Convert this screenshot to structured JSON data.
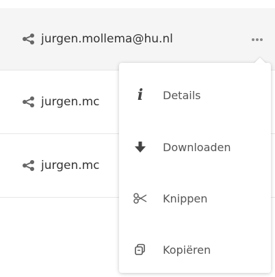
{
  "files": [
    {
      "name": "jurgen.mollema@hu.nl",
      "icon": "share-icon"
    },
    {
      "name": "jurgen.mc",
      "icon": "share-icon"
    },
    {
      "name": "jurgen.mc",
      "icon": "share-icon"
    }
  ],
  "more_button": {
    "icon": "more-horizontal-icon"
  },
  "menu": {
    "items": [
      {
        "label": "Details",
        "icon": "info-icon"
      },
      {
        "label": "Downloaden",
        "icon": "download-icon"
      },
      {
        "label": "Knippen",
        "icon": "scissors-icon"
      },
      {
        "label": "Kopiëren",
        "icon": "copy-icon"
      }
    ]
  },
  "colors": {
    "selected_row_bg": "#f5f5f5",
    "text": "#333333",
    "menu_text": "#555555",
    "divider": "#e6e6e6"
  }
}
